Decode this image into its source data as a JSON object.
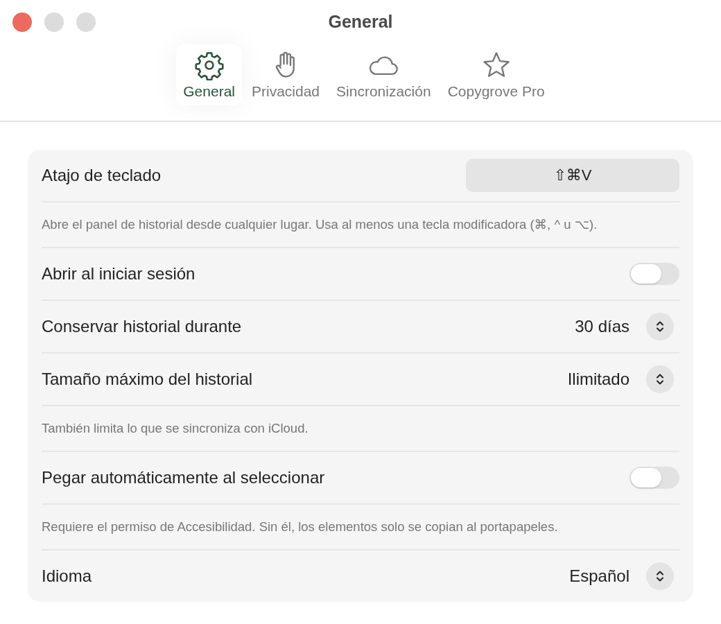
{
  "window": {
    "title": "General"
  },
  "tabs": [
    {
      "label": "General",
      "kind": "gear",
      "selected": true
    },
    {
      "label": "Privacidad",
      "kind": "hand",
      "selected": false
    },
    {
      "label": "Sincronización",
      "kind": "cloud",
      "selected": false
    },
    {
      "label": "Copygrove Pro",
      "kind": "star",
      "selected": false
    }
  ],
  "settings": [
    {
      "kind": "shortcut",
      "label": "Atajo de teclado",
      "value": "⇧⌘V"
    },
    {
      "kind": "note",
      "text": "Abre el panel de historial desde cualquier lugar. Usa al menos una tecla modificadora (⌘, ^ u ⌥)."
    },
    {
      "kind": "toggle",
      "label": "Abrir al iniciar sesión",
      "on": false
    },
    {
      "kind": "select",
      "label": "Conservar historial durante",
      "value": "30 días"
    },
    {
      "kind": "select",
      "label": "Tamaño máximo del historial",
      "value": "Ilimitado"
    },
    {
      "kind": "note",
      "text": "También limita lo que se sincroniza con iCloud."
    },
    {
      "kind": "toggle",
      "label": "Pegar automáticamente al seleccionar",
      "on": false
    },
    {
      "kind": "note",
      "text": "Requiere el permiso de Accesibilidad. Sin él, los elementos solo se copian al portapapeles."
    },
    {
      "kind": "select",
      "label": "Idioma",
      "value": "Español"
    }
  ]
}
